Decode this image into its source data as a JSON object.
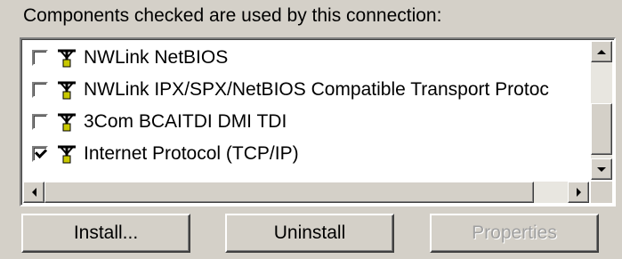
{
  "caption": {
    "label": "Components checked are used by this connection:"
  },
  "components": [
    {
      "label": "NWLink NetBIOS",
      "checked": false
    },
    {
      "label": "NWLink IPX/SPX/NetBIOS Compatible Transport Protoc",
      "checked": false
    },
    {
      "label": "3Com BCAITDI DMI TDI",
      "checked": false
    },
    {
      "label": "Internet Protocol (TCP/IP)",
      "checked": true
    }
  ],
  "buttons": {
    "install": {
      "label": "Install...",
      "enabled": true
    },
    "uninstall": {
      "label": "Uninstall",
      "enabled": true
    },
    "properties": {
      "label": "Properties",
      "enabled": false
    }
  },
  "icons": {
    "protocol": "network-protocol-icon"
  }
}
